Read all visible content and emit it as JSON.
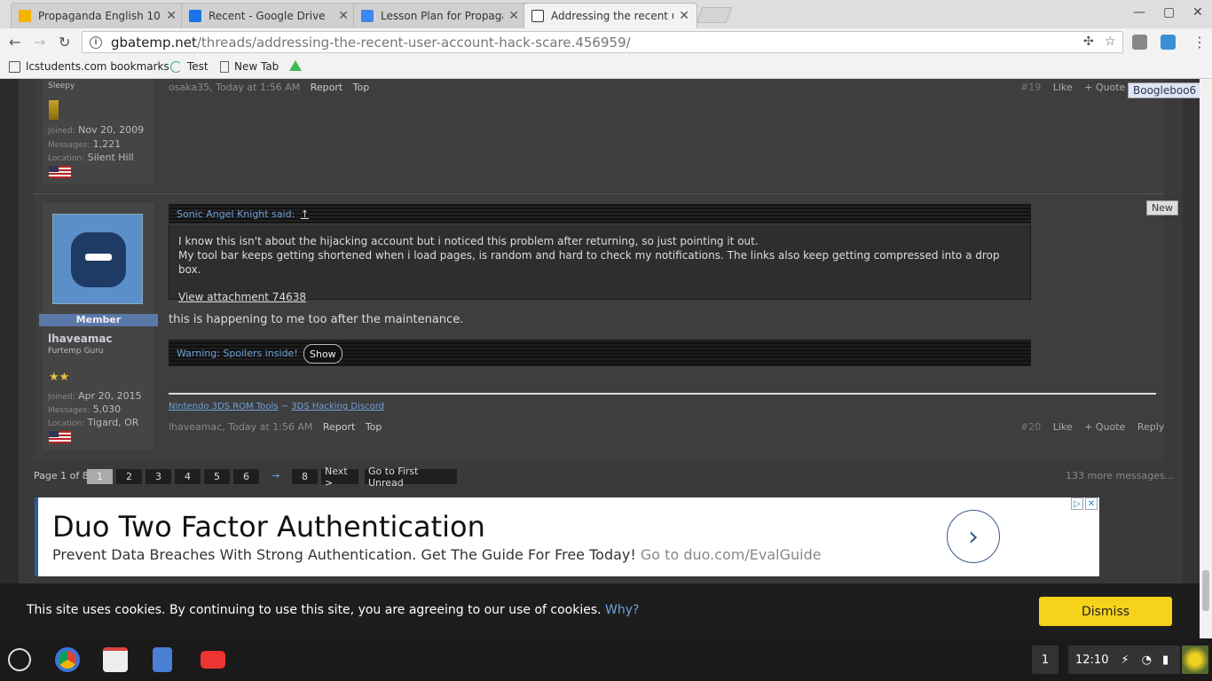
{
  "tabs": [
    {
      "title": "Propaganda English 10",
      "fav": "#f4b400"
    },
    {
      "title": "Recent - Google Drive",
      "fav": "#1a73e8"
    },
    {
      "title": "Lesson Plan for Propaga",
      "fav": "#4285f4"
    },
    {
      "title": "Addressing the recent us",
      "fav": "#333333"
    }
  ],
  "address": {
    "host": "gbatemp.net",
    "path": "/threads/addressing-the-recent-user-account-hack-scare.456959/"
  },
  "bookmarks": [
    "lcstudents.com bookmarks",
    "Test",
    "New Tab"
  ],
  "post19": {
    "rank": "Sleepy",
    "joined_k": "Joined:",
    "joined": "Nov 20, 2009",
    "messages_k": "Messages:",
    "messages": "1,221",
    "location_k": "Location:",
    "location": "Silent Hill",
    "meta_author": "osaka35, Today at 1:56 AM",
    "report": "Report",
    "top": "Top",
    "num": "#19",
    "like": "Like",
    "quote": "+ Quote",
    "username_tag": "Boogleboo6"
  },
  "post20": {
    "badge": "Member",
    "username": "lhaveamac",
    "rank": "Furtemp Guru",
    "joined_k": "Joined:",
    "joined": "Apr 20, 2015",
    "messages_k": "Messages:",
    "messages": "5,030",
    "location_k": "Location:",
    "location": "Tigard, OR",
    "new_tag": "New",
    "quote_head": "Sonic Angel Knight said:",
    "quote_arrow": "↑",
    "quote_line1": "I know this isn't about the hijacking account but i noticed this problem after returning, so just pointing it out.",
    "quote_line2": "My tool bar keeps getting shortened when i load pages, is random and hard to check my notifications. The links also keep getting compressed into a drop box.",
    "attachment": "View attachment 74638",
    "text": "this is happening to me too after the maintenance.",
    "spoiler": "Warning: Spoilers inside!",
    "show": "Show",
    "sig_link1": "Nintendo 3DS ROM Tools",
    "sig_sep": " ~ ",
    "sig_link2": "3DS Hacking Discord",
    "meta_author": "lhaveamac, Today at 1:56 AM",
    "report": "Report",
    "top": "Top",
    "num": "#20",
    "like": "Like",
    "quote": "+ Quote",
    "reply": "Reply"
  },
  "pager": {
    "label": "Page 1 of 8",
    "pages": [
      "1",
      "2",
      "3",
      "4",
      "5",
      "6"
    ],
    "arrow": "→",
    "last": "8",
    "next": "Next >",
    "first_unread": "Go to First Unread",
    "more": "133 more messages..."
  },
  "ad": {
    "title": "Duo Two Factor Authentication",
    "sub": "Prevent Data Breaches With Strong Authentication. Get The Guide For Free Today!",
    "go": "Go to duo.com/EvalGuide",
    "arrow": "›"
  },
  "cookie": {
    "text": "This site uses cookies. By continuing to use this site, you are agreeing to our use of cookies.",
    "why": "Why?",
    "dismiss": "Dismiss"
  },
  "taskbar": {
    "notif_count": "1",
    "time": "12:10"
  },
  "colors": {
    "accent_blue": "#6fa0d8",
    "dismiss_yellow": "#f4d31a"
  }
}
